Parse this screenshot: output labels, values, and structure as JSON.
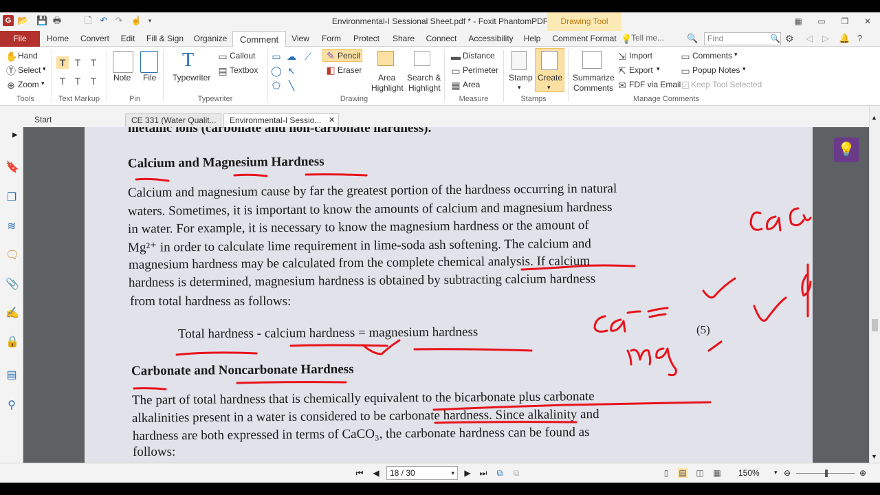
{
  "window": {
    "title": "Environmental-I Sessional Sheet.pdf * - Foxit PhantomPDF",
    "context_tab": "Drawing Tool"
  },
  "menu": {
    "file": "File",
    "tabs": [
      "Home",
      "Convert",
      "Edit",
      "Fill & Sign",
      "Organize",
      "Comment",
      "View",
      "Form",
      "Protect",
      "Share",
      "Connect",
      "Accessibility",
      "Help",
      "Comment Format"
    ],
    "active_tab": "Comment",
    "tell_me": "Tell me...",
    "find_placeholder": "Find"
  },
  "ribbon": {
    "tools": {
      "items": [
        "Hand",
        "Select",
        "Zoom"
      ],
      "group": "Tools"
    },
    "text_markup": {
      "group": "Text Markup"
    },
    "pin": {
      "items": [
        "Note",
        "File"
      ],
      "group": "Pin"
    },
    "typewriter": {
      "items": [
        "Typewriter",
        "Callout",
        "Textbox"
      ],
      "group": "Typewriter"
    },
    "drawing": {
      "items": [
        "Pencil",
        "Eraser",
        "Area Highlight",
        "Search & Highlight"
      ],
      "area_line1": "Area",
      "area_line2": "Highlight",
      "search_line1": "Search &",
      "search_line2": "Highlight",
      "group": "Drawing"
    },
    "measure": {
      "items": [
        "Distance",
        "Perimeter",
        "Area"
      ],
      "group": "Measure"
    },
    "stamps": {
      "items": [
        "Stamp",
        "Create"
      ],
      "group": "Stamps"
    },
    "manage": {
      "summarize_line1": "Summarize",
      "summarize_line2": "Comments",
      "items": [
        "Import",
        "Export",
        "FDF via Email",
        "Comments",
        "Popup Notes",
        "Keep Tool Selected"
      ],
      "group": "Manage Comments"
    }
  },
  "doc_tabs": [
    "Start",
    "CE 331 (Water Qualit...",
    "Environmental-I Sessio..."
  ],
  "document": {
    "top_cut": "metallic ions (carbonate and non-carbonate hardness).",
    "heading1": "Calcium and Magnesium Hardness",
    "para1": [
      "Calcium and magnesium cause by far the greatest portion of the hardness occurring in natural",
      "waters.  Sometimes, it is important to know the amounts of calcium and magnesium hardness",
      "in water.  For example, it is necessary to know the magnesium hardness or the amount of",
      "Mg²⁺ in order to calculate lime requirement in lime-soda ash softening.  The calcium and",
      "magnesium hardness may be calculated from the complete chemical analysis.  If calcium",
      "hardness is determined, magnesium hardness is obtained by subtracting calcium hardness",
      "from total hardness as follows:"
    ],
    "equation": "Total hardness - calcium hardness = magnesium hardness",
    "eq_number": "(5)",
    "heading2": "Carbonate and Noncarbonate Hardness",
    "para2": [
      "The part of total hardness that is chemically equivalent to the bicarbonate plus carbonate",
      "alkalinities present in a water is considered to be carbonate hardness.  Since alkalinity and",
      "hardness are both expressed in terms of CaCO₃, the carbonate hardness can be found as",
      "follows:"
    ],
    "ink_color": "#e8131b"
  },
  "status": {
    "page_indicator": "18 / 30",
    "zoom": "150%"
  }
}
